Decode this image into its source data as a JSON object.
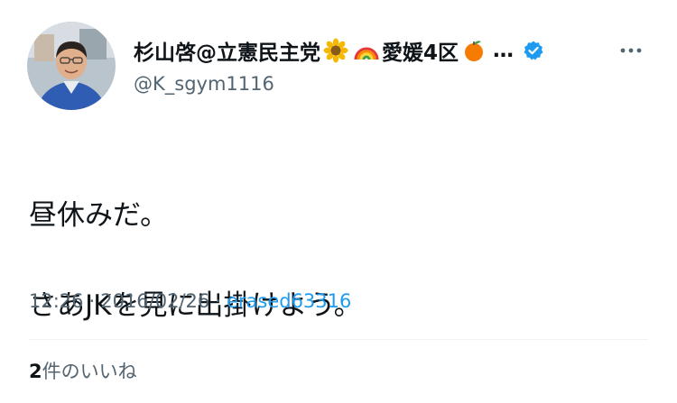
{
  "author": {
    "display_name": "杉山啓@立憲民主党",
    "name_suffix": "愛媛4区",
    "ellipsis": "…",
    "handle": "@K_sgym1116",
    "emojis": [
      "sunflower-icon",
      "rainbow-icon",
      "orange-icon"
    ],
    "verified_color": "#1d9bf0"
  },
  "tweet": {
    "text_line1": "昼休みだ。",
    "text_line2": "さあJKを見に出掛けよう。"
  },
  "meta": {
    "time": "12:26",
    "separator": "·",
    "date": "2016/02/26",
    "source": "erased63316"
  },
  "engagement": {
    "like_count": "2",
    "like_label": "件のいいね"
  },
  "colors": {
    "text": "#0f1419",
    "secondary": "#536471",
    "accent": "#1d9bf0",
    "divider": "#eff3f4"
  }
}
